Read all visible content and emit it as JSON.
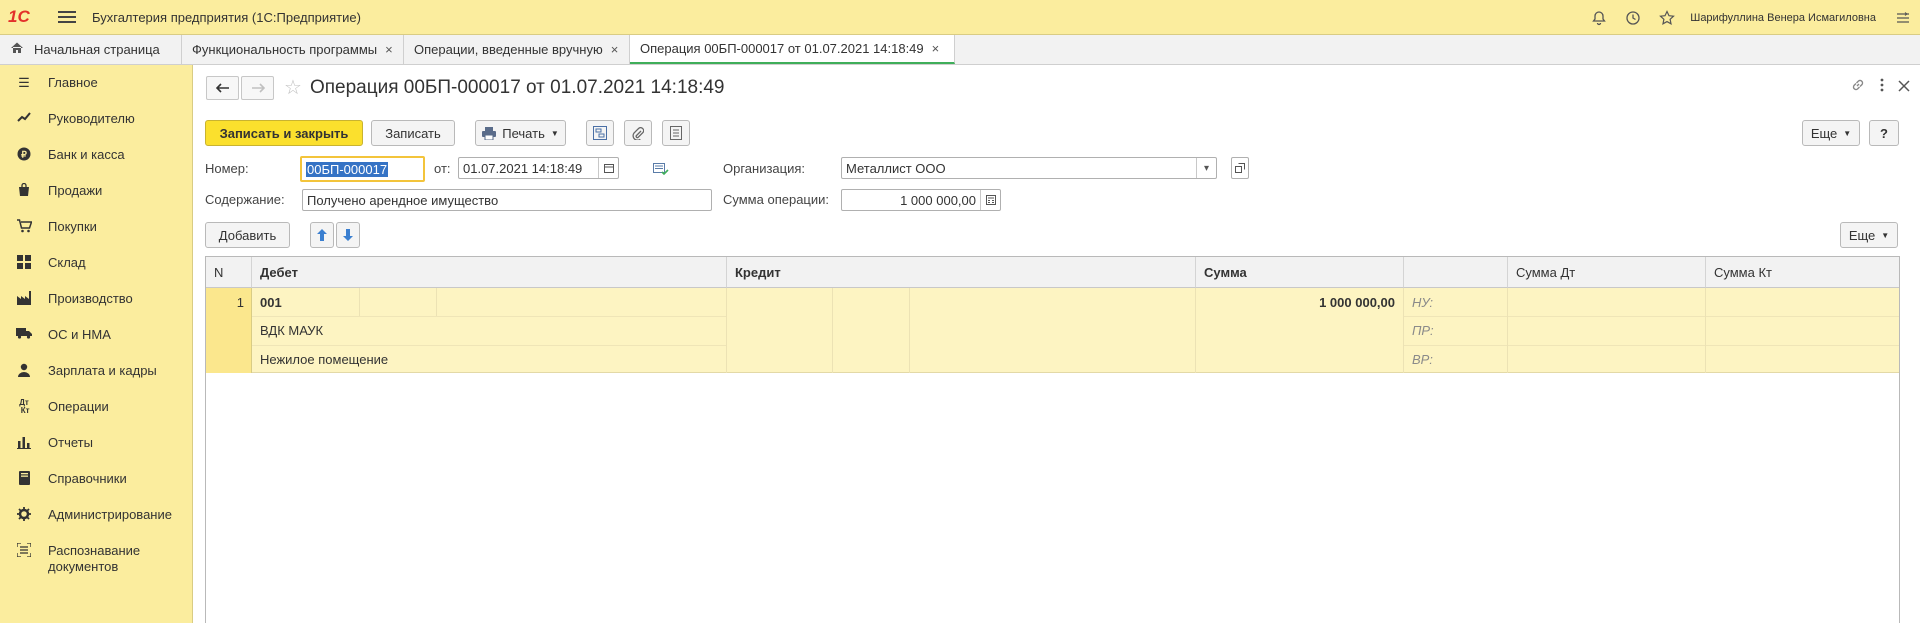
{
  "app": {
    "logo": "1С",
    "title": "Бухгалтерия предприятия  (1С:Предприятие)",
    "user": "Шарифуллина Венера Исмагиловна"
  },
  "tabs": [
    {
      "label": "Начальная страница"
    },
    {
      "label": "Функциональность программы",
      "close": "×"
    },
    {
      "label": "Операции, введенные вручную",
      "close": "×"
    },
    {
      "label": "Операция 00БП-000017 от 01.07.2021 14:18:49",
      "close": "×"
    }
  ],
  "sidebar": {
    "items": [
      {
        "label": "Главное",
        "icon": "menu-icon"
      },
      {
        "label": "Руководителю",
        "icon": "trend-icon"
      },
      {
        "label": "Банк и касса",
        "icon": "ruble-icon"
      },
      {
        "label": "Продажи",
        "icon": "bag-icon"
      },
      {
        "label": "Покупки",
        "icon": "cart-icon"
      },
      {
        "label": "Склад",
        "icon": "warehouse-icon"
      },
      {
        "label": "Производство",
        "icon": "factory-icon"
      },
      {
        "label": "ОС и НМА",
        "icon": "truck-icon"
      },
      {
        "label": "Зарплата и кадры",
        "icon": "person-icon"
      },
      {
        "label": "Операции",
        "icon": "dt-kt-icon"
      },
      {
        "label": "Отчеты",
        "icon": "bar-chart-icon"
      },
      {
        "label": "Справочники",
        "icon": "book-icon"
      },
      {
        "label": "Администрирование",
        "icon": "gear-icon"
      },
      {
        "label": "Распознавание документов",
        "icon": "scan-icon"
      }
    ]
  },
  "form": {
    "title": "Операция 00БП-000017 от 01.07.2021 14:18:49",
    "buttons": {
      "save_close": "Записать и закрыть",
      "save": "Записать",
      "print": "Печать",
      "more": "Еще",
      "help": "?",
      "add": "Добавить",
      "more2": "Еще"
    },
    "number_label": "Номер:",
    "number_value": "00БП-000017",
    "date_label": "от:",
    "date_value": "01.07.2021 14:18:49",
    "org_label": "Организация:",
    "org_value": "Металлист ООО",
    "content_label": "Содержание:",
    "content_value": "Получено арендное имущество",
    "sum_label": "Сумма операции:",
    "sum_value": "1 000 000,00"
  },
  "table": {
    "headers": {
      "n": "N",
      "debit": "Дебет",
      "credit": "Кредит",
      "sum": "Сумма",
      "sum_dt": "Сумма Дт",
      "sum_kt": "Сумма Кт"
    },
    "row": {
      "n": "1",
      "debit_account": "001",
      "debit_sub1": "ВДК МАУК",
      "debit_sub2": "Нежилое помещение",
      "sum": "1 000 000,00",
      "tag_nu": "НУ:",
      "tag_pr": "ПР:",
      "tag_vr": "ВР:"
    }
  }
}
